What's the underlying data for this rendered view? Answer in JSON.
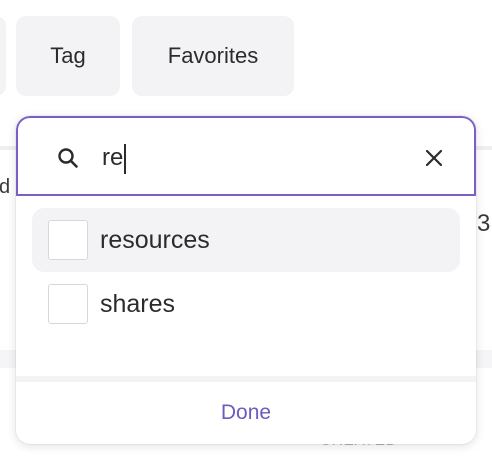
{
  "filters": {
    "chips": [
      {
        "label": "Tag"
      },
      {
        "label": "Favorites"
      }
    ]
  },
  "background": {
    "left_fragment": "d",
    "right_fragment": "3",
    "bottom_fragment": "CREATED"
  },
  "popover": {
    "search": {
      "value": "re",
      "icon": "search-icon",
      "clear_icon": "close-icon"
    },
    "options": [
      {
        "label": "resources",
        "checked": false,
        "highlighted": true
      },
      {
        "label": "shares",
        "checked": false,
        "highlighted": false
      }
    ],
    "done_label": "Done"
  },
  "colors": {
    "accent": "#7a5fc4",
    "done_text": "#6f5bbf",
    "chip_bg": "#f3f3f5"
  }
}
